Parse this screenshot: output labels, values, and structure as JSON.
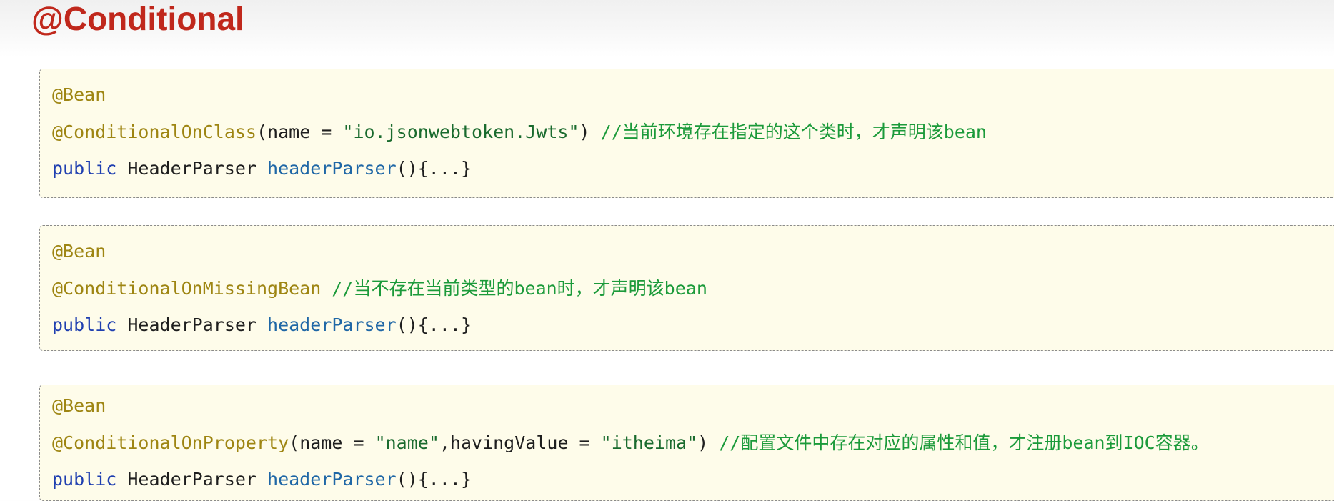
{
  "page": {
    "title": "@Conditional"
  },
  "blocks": [
    {
      "line1": {
        "annotation": "@Bean"
      },
      "line2": {
        "annotation": "@ConditionalOnClass",
        "args_open": "(name = ",
        "string1": "\"io.jsonwebtoken.Jwts\"",
        "args_close": ") ",
        "comment": "//当前环境存在指定的这个类时，才声明该bean"
      },
      "line3": {
        "keyword": "public",
        "type": " HeaderParser ",
        "method": "headerParser",
        "body": "(){...}"
      }
    },
    {
      "line1": {
        "annotation": "@Bean"
      },
      "line2": {
        "annotation": "@ConditionalOnMissingBean",
        "space": " ",
        "comment": "//当不存在当前类型的bean时，才声明该bean"
      },
      "line3": {
        "keyword": "public",
        "type": " HeaderParser ",
        "method": "headerParser",
        "body": "(){...}"
      }
    },
    {
      "line1": {
        "annotation": "@Bean"
      },
      "line2": {
        "annotation": "@ConditionalOnProperty",
        "args_open": "(name = ",
        "string1": "\"name\"",
        "args_mid": ",havingValue = ",
        "string2": "\"itheima\"",
        "args_close": ") ",
        "comment": "//配置文件中存在对应的属性和值，才注册bean到IOC容器。"
      },
      "line3": {
        "keyword": "public",
        "type": " HeaderParser ",
        "method": "headerParser",
        "body": "(){...}"
      }
    }
  ],
  "colors": {
    "title": "#c0281c",
    "code_background": "#fefcea",
    "annotation": "#9e8512",
    "keyword": "#1f3fb0",
    "method": "#1f67a6",
    "string": "#1a6b2e",
    "comment": "#1b9a3a"
  }
}
